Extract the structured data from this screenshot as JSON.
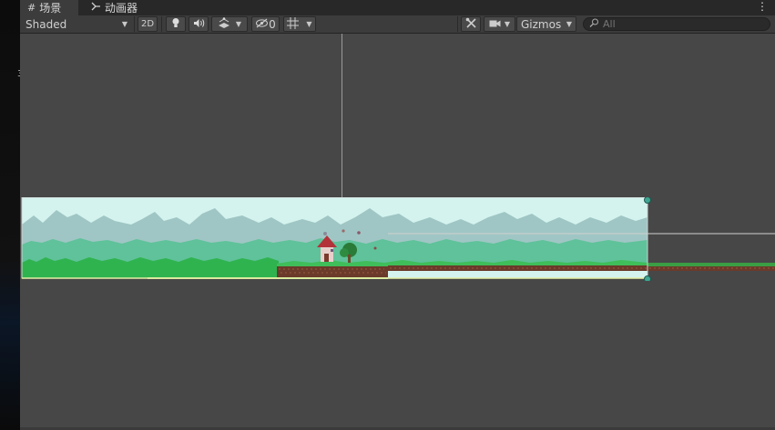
{
  "tabs": [
    {
      "label": "场景",
      "icon": "grid-icon"
    },
    {
      "label": "动画器",
      "icon": "animator-icon"
    }
  ],
  "tab_menu_icon": "more-vertical-icon",
  "toolbar": {
    "shading_mode": "Shaded",
    "toggle_2d": "2D",
    "hidden_count": "0",
    "gizmos_label": "Gizmos",
    "icons": {
      "lighting": "lightbulb-icon",
      "audio": "speaker-icon",
      "effects": "effects-icon",
      "hidden": "eye-slash-icon",
      "grid": "grid-snap-icon",
      "tools": "tools-icon",
      "camera": "camera-icon"
    },
    "search_placeholder": "All"
  },
  "left_edge_text": "3",
  "colors": {
    "panel": "#3c3c3c",
    "viewport": "#474747",
    "sky": "#d4f3ef",
    "grass": "#2fb34f",
    "dirt": "#6b3a2a",
    "handle": "#3fa592"
  }
}
